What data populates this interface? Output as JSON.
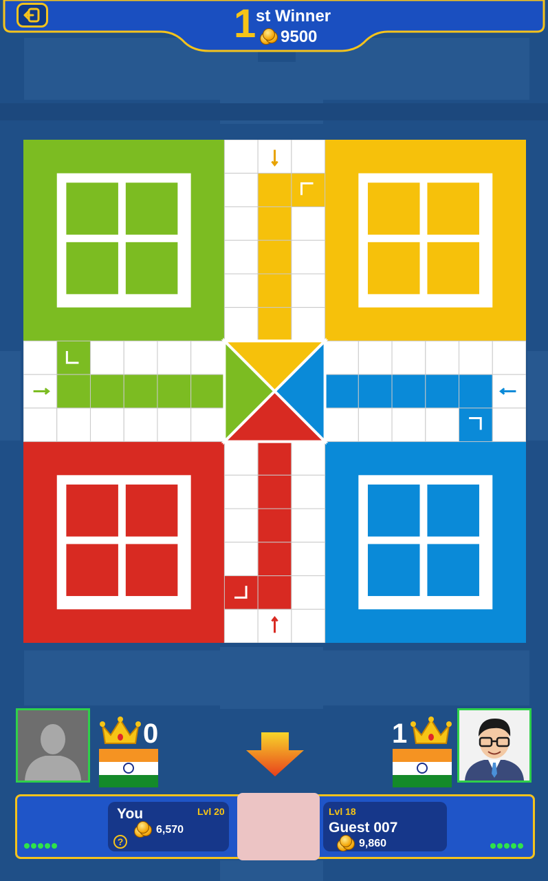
{
  "header": {
    "rank_number": "1",
    "rank_suffix": "st Winner",
    "prize": "9500"
  },
  "board": {
    "colors": {
      "green": "#7cbc22",
      "yellow": "#f6c10b",
      "red": "#d82a22",
      "blue": "#0a8ad8",
      "grid": "#c8c8c8"
    }
  },
  "players": {
    "left": {
      "score": "0",
      "name": "You",
      "level": "Lvl 20",
      "coins": "6,570"
    },
    "right": {
      "score": "1",
      "name": "Guest 007",
      "level": "Lvl 18",
      "coins": "9,860"
    }
  },
  "icons": {
    "back": "back-arrow-icon",
    "crown": "crown-icon",
    "flag": "india-flag-icon",
    "coins": "coin-stack-icon",
    "help": "question-icon",
    "turn": "down-arrow-icon"
  }
}
